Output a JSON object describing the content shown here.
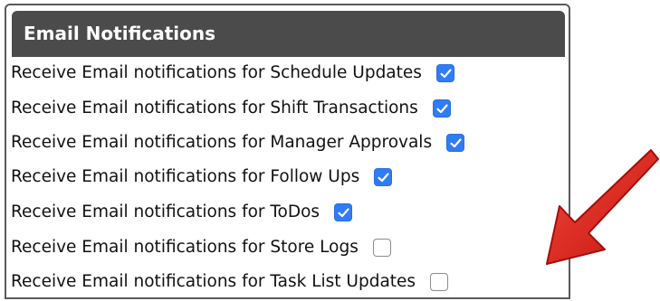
{
  "panel": {
    "title": "Email Notifications"
  },
  "notifications": [
    {
      "label": "Receive Email notifications for Schedule Updates",
      "checked": true
    },
    {
      "label": "Receive Email notifications for Shift Transactions",
      "checked": true
    },
    {
      "label": "Receive Email notifications for Manager Approvals",
      "checked": true
    },
    {
      "label": "Receive Email notifications for Follow Ups",
      "checked": true
    },
    {
      "label": "Receive Email notifications for ToDos",
      "checked": true
    },
    {
      "label": "Receive Email notifications for Store Logs",
      "checked": false
    },
    {
      "label": "Receive Email notifications for Task List Updates",
      "checked": false
    }
  ],
  "colors": {
    "header_bg": "#4b4b4b",
    "checkbox_checked": "#2f7cf6",
    "arrow": "#e0201b"
  },
  "annotation": {
    "arrow_icon": "red-arrow-icon"
  }
}
